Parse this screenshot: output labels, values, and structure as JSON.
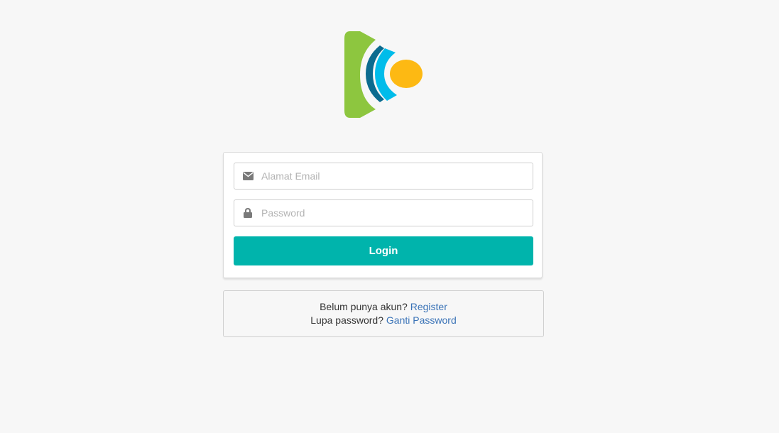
{
  "brand": {
    "logo_icon": "play-logo-icon",
    "colors": {
      "green": "#8dc63f",
      "dark_blue": "#0b6b8f",
      "cyan": "#00bcea",
      "orange": "#fdb913"
    }
  },
  "login_form": {
    "email": {
      "icon": "envelope-icon",
      "placeholder": "Alamat Email",
      "value": ""
    },
    "password": {
      "icon": "lock-icon",
      "placeholder": "Password",
      "value": ""
    },
    "submit_label": "Login",
    "accent_color": "#00b4ac"
  },
  "links": {
    "register_prompt": "Belum punya akun?",
    "register_label": "Register",
    "forgot_prompt": "Lupa password?",
    "forgot_label": "Ganti Password",
    "link_color": "#3a73b7"
  }
}
